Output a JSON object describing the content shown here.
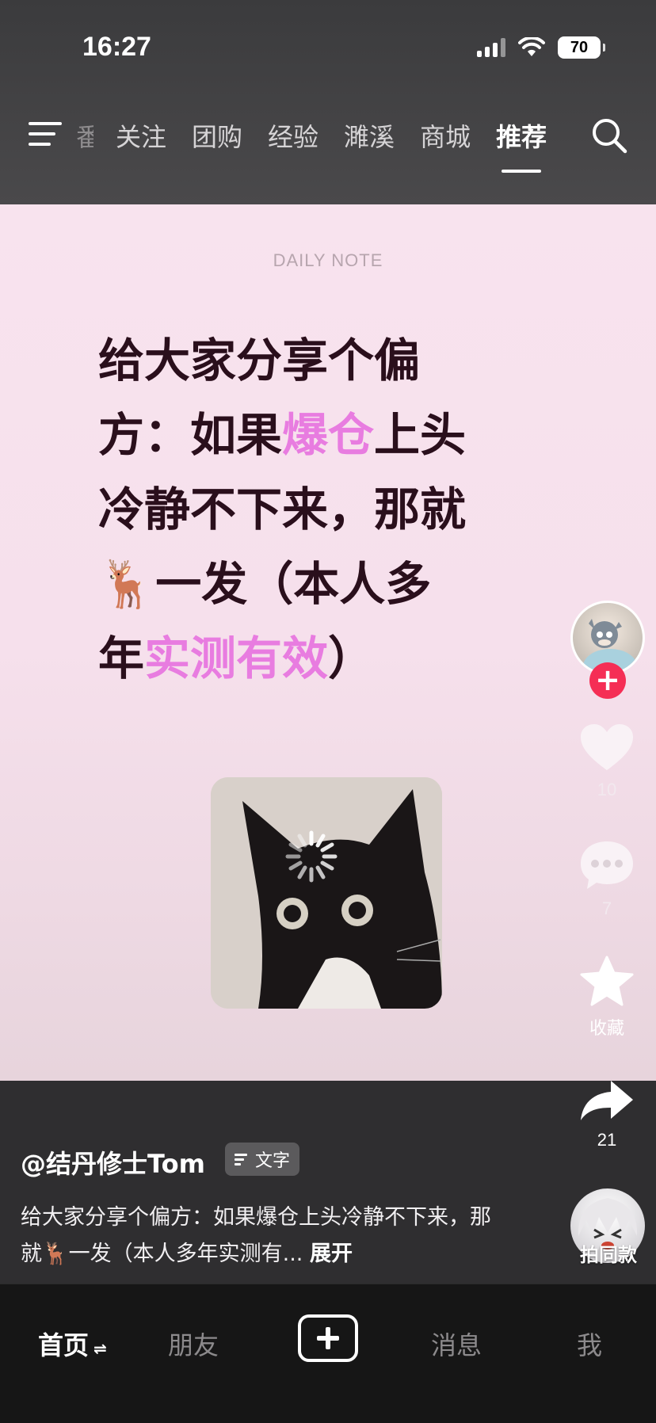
{
  "status_bar": {
    "time": "16:27",
    "battery": "70"
  },
  "top_nav": {
    "tabs": [
      {
        "label": "番",
        "active": false,
        "partial": true
      },
      {
        "label": "关注",
        "active": false
      },
      {
        "label": "团购",
        "active": false
      },
      {
        "label": "经验",
        "active": false
      },
      {
        "label": "濉溪",
        "active": false
      },
      {
        "label": "商城",
        "active": false
      },
      {
        "label": "推荐",
        "active": true
      }
    ]
  },
  "post": {
    "daily_note": "DAILY NOTE",
    "headline": {
      "line1": "给大家分享个偏",
      "line2_a": "方：如果",
      "line2_hl": "爆仓",
      "line2_b": "上头",
      "line3": "冷静不下来，那就",
      "line4_emoji": "🦌",
      "line4": "一发（本人多",
      "line5_a": "年",
      "line5_hl": "实测有效",
      "line5_b": "）"
    },
    "highlight_color": "#e87ce0"
  },
  "right_rail": {
    "like_count": "10",
    "comment_count": "7",
    "favorite_label": "收藏",
    "share_count": "21",
    "remix_label": "拍同款"
  },
  "caption": {
    "author": "@结丹修士Tom",
    "badge": "文字",
    "text": "给大家分享个偏方：如果爆仓上头冷静不下来，那就🦌一发（本人多年实测有...",
    "expand": "展开"
  },
  "bottom_tabs": {
    "home": "首页",
    "friends": "朋友",
    "messages": "消息",
    "me": "我"
  }
}
